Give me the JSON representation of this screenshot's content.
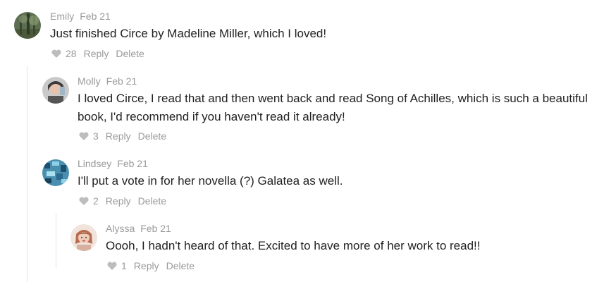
{
  "comments": [
    {
      "author": "Emily",
      "date": "Feb 21",
      "text": "Just finished Circe by Madeline Miller, which I loved!",
      "likes": "28",
      "reply_label": "Reply",
      "delete_label": "Delete"
    },
    {
      "author": "Molly",
      "date": "Feb 21",
      "text": "I loved Circe, I read that and then went back and read Song of Achilles, which is such a beautiful book, I'd recommend if you haven't read it already!",
      "likes": "3",
      "reply_label": "Reply",
      "delete_label": "Delete"
    },
    {
      "author": "Lindsey",
      "date": "Feb 21",
      "text": "I'll put a vote in for her novella (?) Galatea as well.",
      "likes": "2",
      "reply_label": "Reply",
      "delete_label": "Delete"
    },
    {
      "author": "Alyssa",
      "date": "Feb 21",
      "text": "Oooh, I hadn't heard of that. Excited to have more of her work to read!!",
      "likes": "1",
      "reply_label": "Reply",
      "delete_label": "Delete"
    }
  ],
  "colors": {
    "meta": "#9a9a9a",
    "text": "#1f1f1f",
    "thread_line": "#e4e4e4",
    "heart": "#bdbdbd"
  }
}
